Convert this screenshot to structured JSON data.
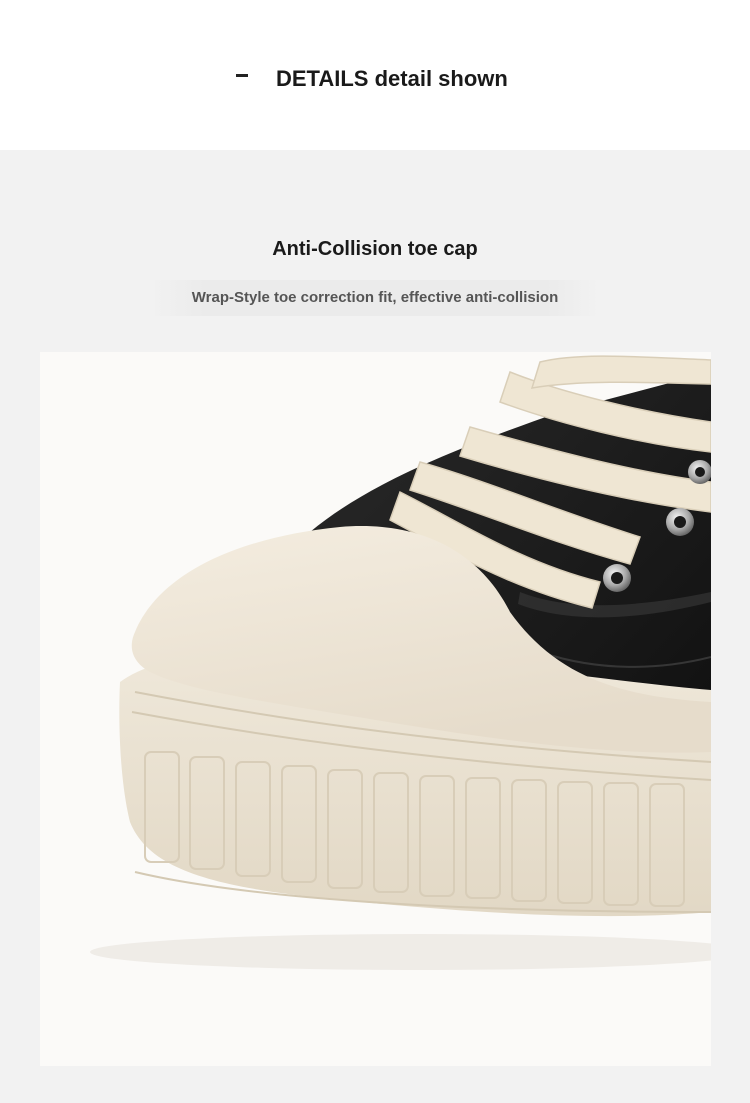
{
  "header": {
    "title": "DETAILS detail shown"
  },
  "feature": {
    "title": "Anti-Collision toe cap",
    "subtitle": "Wrap-Style toe correction fit, effective anti-collision"
  },
  "colors": {
    "page_bg": "#f2f2f2",
    "header_bg": "#ffffff",
    "sole_cream": "#ede5d6",
    "upper_black": "#1c1c1c",
    "lace_cream": "#efe6d3"
  }
}
